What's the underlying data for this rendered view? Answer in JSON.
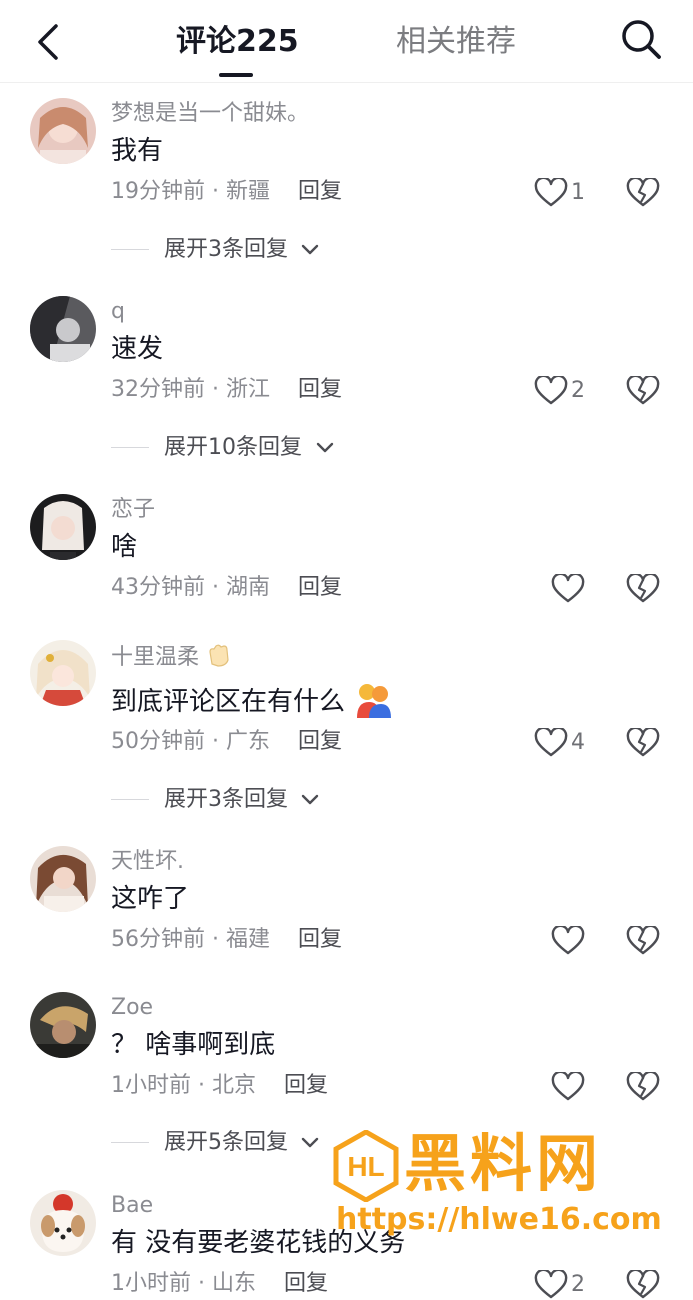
{
  "header": {
    "tab_comments": "评论225",
    "tab_related": "相关推荐"
  },
  "comments": [
    {
      "username": "梦想是当一个甜妹。",
      "text": "我有",
      "time": "19分钟前",
      "location": "新疆",
      "reply": "回复",
      "likes": "1",
      "expand": "展开3条回复"
    },
    {
      "username": "q",
      "text": "速发",
      "time": "32分钟前",
      "location": "浙江",
      "reply": "回复",
      "likes": "2",
      "expand": "展开10条回复"
    },
    {
      "username": "恋子",
      "text": "啥",
      "time": "43分钟前",
      "location": "湖南",
      "reply": "回复",
      "likes": ""
    },
    {
      "username": "十里温柔",
      "text": "到底评论区在有什么",
      "time": "50分钟前",
      "location": "广东",
      "reply": "回复",
      "likes": "4",
      "expand": "展开3条回复"
    },
    {
      "username": "天性坏.",
      "text": "这咋了",
      "time": "56分钟前",
      "location": "福建",
      "reply": "回复",
      "likes": ""
    },
    {
      "username": "Zoe",
      "text": "？ 啥事啊到底",
      "time": "1小时前",
      "location": "北京",
      "reply": "回复",
      "likes": "",
      "expand": "展开5条回复"
    },
    {
      "username": "Bae",
      "text": "有 没有要老婆花钱的义务",
      "time": "1小时前",
      "location": "山东",
      "reply": "回复",
      "likes": "2"
    }
  ],
  "meta_separator": " · ",
  "watermark": {
    "title": "黑料网",
    "url": "https://hlwe16.com"
  },
  "colors": {
    "accent": "#f6a21b",
    "text_primary": "#161823",
    "text_secondary": "#8a8b91"
  }
}
